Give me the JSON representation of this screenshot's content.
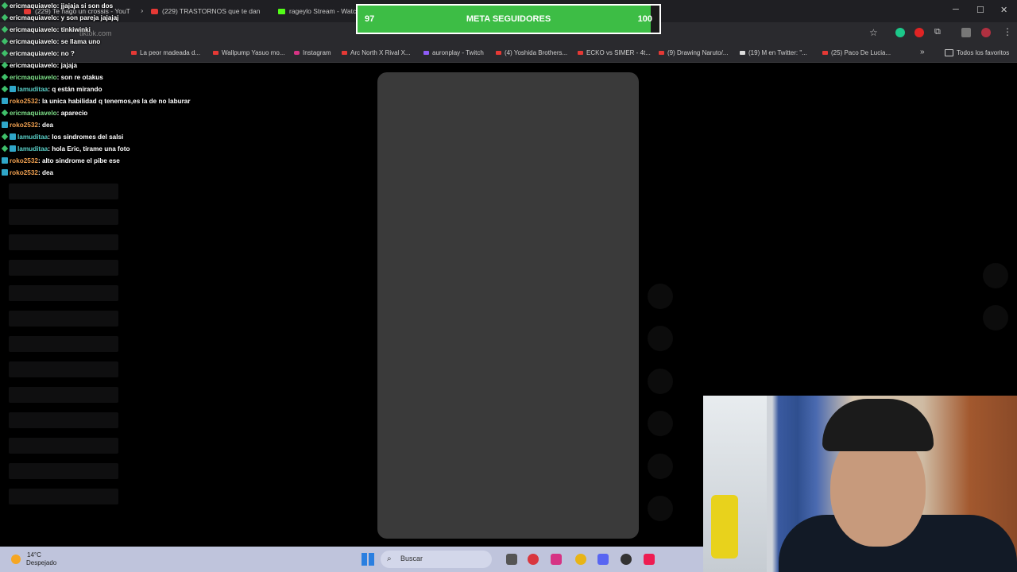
{
  "tabs": [
    {
      "label": "(229) Te hago un crossis - YouT",
      "close": "×"
    },
    {
      "label": "(229) TRASTORNOS que te dan",
      "close": "×"
    },
    {
      "label": "rageylo Stream - Watch"
    }
  ],
  "address": {
    "url": "tiktok.com"
  },
  "bookmarks": [
    "La peor madeada d...",
    "Wallpump Yasuo mo...",
    "Instagram",
    "Arc North X Rival X...",
    "auronplay - Twitch",
    "(4) Yoshida Brothers...",
    "ECKO vs SIMER - 4t...",
    "(9) Drawing Naruto/...",
    "(19) M en Twitter: \"...",
    "(25) Paco De Lucia...",
    "Todos los favoritos"
  ],
  "chat": [
    {
      "user": "ericmaquiavelo",
      "text": ": jjajaja si son dos",
      "badge": "green",
      "color": "white"
    },
    {
      "user": "ericmaquiavelo",
      "text": ": y son pareja jajajaj",
      "badge": "green",
      "color": "white"
    },
    {
      "user": "ericmaquiavelo",
      "text": ": tinkiwinki",
      "badge": "green",
      "color": "white"
    },
    {
      "user": "ericmaquiavelo",
      "text": ": se llama uno",
      "badge": "green",
      "color": "white"
    },
    {
      "user": "ericmaquiavelo",
      "text": ": no ?",
      "badge": "green",
      "color": "white"
    },
    {
      "user": "ericmaquiavelo",
      "text": ": jajaja",
      "badge": "green",
      "color": "white"
    },
    {
      "user": "ericmaquiavelo",
      "text": ": son re otakus",
      "badge": "green",
      "color": "green"
    },
    {
      "user": "lamuditaa",
      "text": ": q están mirando",
      "badge": "both",
      "color": "cyan"
    },
    {
      "user": "roko2532",
      "text": ": la unica habilidad q tenemos,es la de no laburar",
      "badge": "sub",
      "color": "orange"
    },
    {
      "user": "ericmaquiavelo",
      "text": ": aparecio",
      "badge": "green",
      "color": "green"
    },
    {
      "user": "roko2532",
      "text": ": dea",
      "badge": "sub",
      "color": "orange"
    },
    {
      "user": "lamuditaa",
      "text": ": los síndromes del salsi",
      "badge": "both",
      "color": "cyan"
    },
    {
      "user": "lamuditaa",
      "text": ": hola Eric, tirame una foto",
      "badge": "both",
      "color": "cyan"
    },
    {
      "user": "roko2532",
      "text": ": alto sindrome el pibe ese",
      "badge": "sub",
      "color": "orange"
    },
    {
      "user": "roko2532",
      "text": ": dea",
      "badge": "sub",
      "color": "orange"
    }
  ],
  "goal": {
    "current": "97",
    "label": "META SEGUIDORES",
    "target": "100",
    "progress": 0.97,
    "color": "#3dbd45"
  },
  "taskbar": {
    "temp": "14°C",
    "weather": "Despejado",
    "search_label": "Buscar"
  },
  "window_controls": {
    "minimize": "─",
    "maximize": "☐",
    "close": "✕"
  },
  "icons": {
    "star": "☆",
    "extensions": "⧉",
    "menu": "⋮",
    "search": "⌕",
    "chevron": "»"
  }
}
